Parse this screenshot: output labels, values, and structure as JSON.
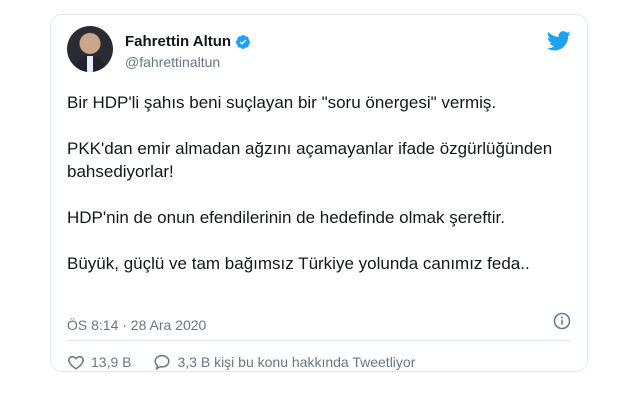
{
  "author": {
    "display_name": "Fahrettin Altun",
    "handle": "@fahrettinaltun"
  },
  "tweet": {
    "paragraphs": [
      "Bir HDP'li şahıs beni suçlayan bir \"soru önergesi\" vermiş.",
      "PKK'dan emir almadan ağzını açamayanlar ifade özgürlüğünden bahsediyorlar!",
      "HDP'nin de onun efendilerinin de hedefinde olmak şereftir.",
      "Büyük, güçlü ve tam bağımsız Türkiye yolunda canımız feda.."
    ],
    "timestamp": "ÖS 8:14 · 28 Ara 2020"
  },
  "actions": {
    "likes": "13,9 B",
    "replies_text": "3,3 B kişi bu konu hakkında Tweetliyor"
  },
  "icons": {
    "bird": "twitter-bird-icon",
    "verified": "verified-badge-icon",
    "info": "info-icon",
    "heart": "heart-icon",
    "reply": "speech-bubble-icon"
  },
  "colors": {
    "brand_blue": "#1da1f2",
    "text": "#14171a",
    "secondary": "#657786",
    "border": "#e1e8ed"
  }
}
